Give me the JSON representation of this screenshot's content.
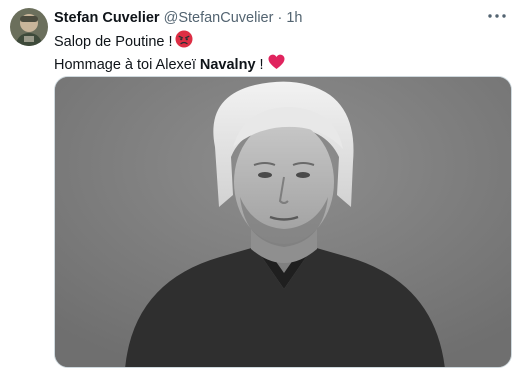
{
  "tweet": {
    "author_name": "Stefan Cuvelier",
    "author_handle": "@StefanCuvelier",
    "separator": "·",
    "time": "1h",
    "line1_text": "Salop de Poutine !",
    "line2_prefix": "Hommage à toi Alexeï ",
    "line2_bold": "Navalny",
    "line2_suffix": " !",
    "icons": {
      "avatar": "avatar-image",
      "more": "more-options-icon",
      "angry": "angry-face-emoji",
      "heart": "red-heart-emoji"
    },
    "colors": {
      "text": "#0f1419",
      "secondary": "#536471",
      "heart": "#e0245e",
      "angry": "#dd2e44"
    }
  }
}
